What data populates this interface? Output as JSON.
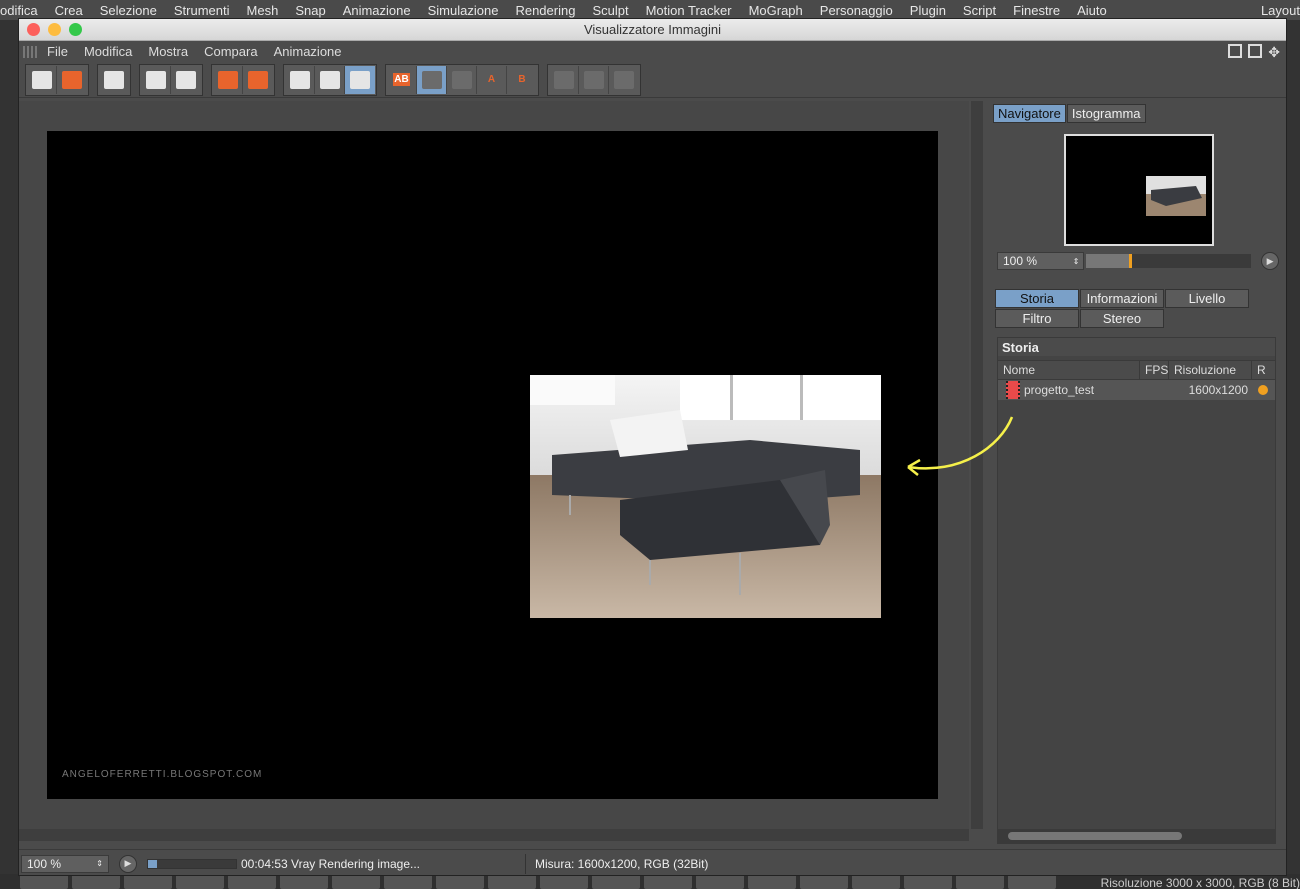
{
  "top_menu": [
    "odifica",
    "Crea",
    "Selezione",
    "Strumenti",
    "Mesh",
    "Snap",
    "Animazione",
    "Simulazione",
    "Rendering",
    "Sculpt",
    "Motion Tracker",
    "MoGraph",
    "Personaggio",
    "Plugin",
    "Script",
    "Finestre",
    "Aiuto"
  ],
  "top_menu_right": "Layout",
  "window": {
    "title": "Visualizzatore Immagini",
    "traffic_colors": [
      "#fc605c",
      "#fdbc40",
      "#34c84a"
    ]
  },
  "menu": [
    "File",
    "Modifica",
    "Mostra",
    "Compara",
    "Animazione"
  ],
  "toolbar": {
    "ab_label": "AB",
    "a_label": "A",
    "b_label": "B"
  },
  "canvas": {
    "watermark": "ANGELOFERRETTI.BLOGSPOT.COM"
  },
  "panel": {
    "top_tabs": [
      "Navigatore",
      "Istogramma"
    ],
    "zoom": "100 %",
    "zoom_slider_fraction": 0.26,
    "tabs_row1": [
      "Storia",
      "Informazioni",
      "Livello"
    ],
    "tabs_row2": [
      "Filtro",
      "Stereo"
    ],
    "history": {
      "title": "Storia",
      "columns": [
        "Nome",
        "FPS",
        "Risoluzione",
        "R"
      ],
      "rows": [
        {
          "name": "progetto_test",
          "fps": "",
          "resolution": "1600x1200",
          "status_color": "#f0a020"
        }
      ]
    }
  },
  "status": {
    "zoom": "100 %",
    "progress_fraction": 0.1,
    "message": "00:04:53 Vray Rendering image...",
    "size_info": "Misura: 1600x1200, RGB (32Bit)"
  },
  "background_resolution": "Risoluzione 3000 x 3000, RGB (8 Bit)",
  "accent_color": "#7aa0c8",
  "annotation_arrow_color": "#f5f04a"
}
